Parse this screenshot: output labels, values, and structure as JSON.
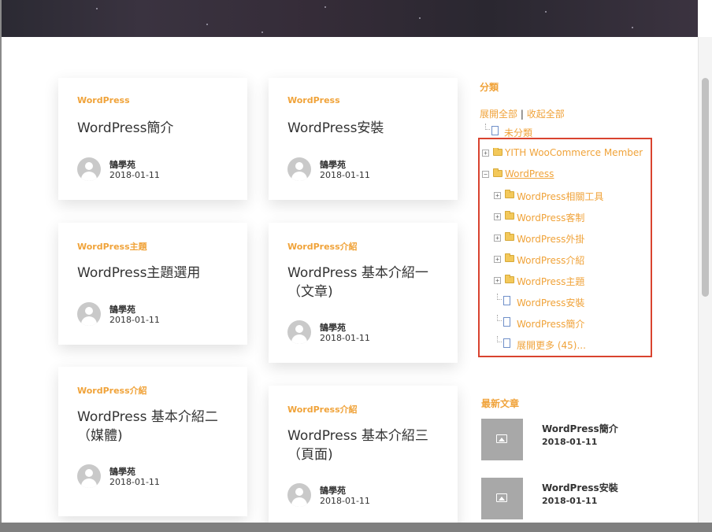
{
  "posts": [
    {
      "category": "WordPress",
      "title": "WordPress簡介",
      "author": "鵠學苑",
      "date": "2018-01-11"
    },
    {
      "category": "WordPress",
      "title": "WordPress安裝",
      "author": "鵠學苑",
      "date": "2018-01-11"
    },
    {
      "category": "WordPress主題",
      "title": "WordPress主題選用",
      "author": "鵠學苑",
      "date": "2018-01-11"
    },
    {
      "category": "WordPress介紹",
      "title": "WordPress 基本介紹一（文章)",
      "author": "鵠學苑",
      "date": "2018-01-11"
    },
    {
      "category": "WordPress介紹",
      "title": "WordPress 基本介紹二（媒體)",
      "author": "鵠學苑",
      "date": "2018-01-11"
    },
    {
      "category": "WordPress介紹",
      "title": "WordPress 基本介紹三（頁面)",
      "author": "鵠學苑",
      "date": "2018-01-11"
    }
  ],
  "sidebar": {
    "categories_title": "分類",
    "expand_all": "展開全部",
    "separator": "|",
    "collapse_all": "收起全部",
    "tree": [
      {
        "label": "未分類",
        "icon": "page-icon",
        "toggle": ""
      },
      {
        "label": "YITH WooCommerce Membership",
        "icon": "folder-icon",
        "toggle": "+"
      },
      {
        "label": "WordPress",
        "icon": "folder-open-icon",
        "toggle": "−"
      },
      {
        "label": "WordPress相關工具",
        "icon": "folder-icon",
        "toggle": "+"
      },
      {
        "label": "WordPress客制",
        "icon": "folder-icon",
        "toggle": "+"
      },
      {
        "label": "WordPress外掛",
        "icon": "folder-icon",
        "toggle": "+"
      },
      {
        "label": "WordPress介紹",
        "icon": "folder-icon",
        "toggle": "+"
      },
      {
        "label": "WordPress主題",
        "icon": "folder-icon",
        "toggle": "+"
      },
      {
        "label": "WordPress安裝",
        "icon": "page-icon",
        "toggle": ""
      },
      {
        "label": "WordPress簡介",
        "icon": "page-icon",
        "toggle": ""
      },
      {
        "label": "展開更多 (45)...",
        "icon": "page-icon",
        "toggle": ""
      }
    ],
    "recent_title": "最新文章",
    "recent": [
      {
        "title": "WordPress簡介",
        "date": "2018-01-11",
        "icon": "image-placeholder-icon"
      },
      {
        "title": "WordPress安裝",
        "date": "2018-01-11",
        "icon": "image-placeholder-icon"
      }
    ]
  },
  "colors": {
    "accent": "#f0a33a",
    "highlight": "#d9432f",
    "text": "#333333"
  }
}
